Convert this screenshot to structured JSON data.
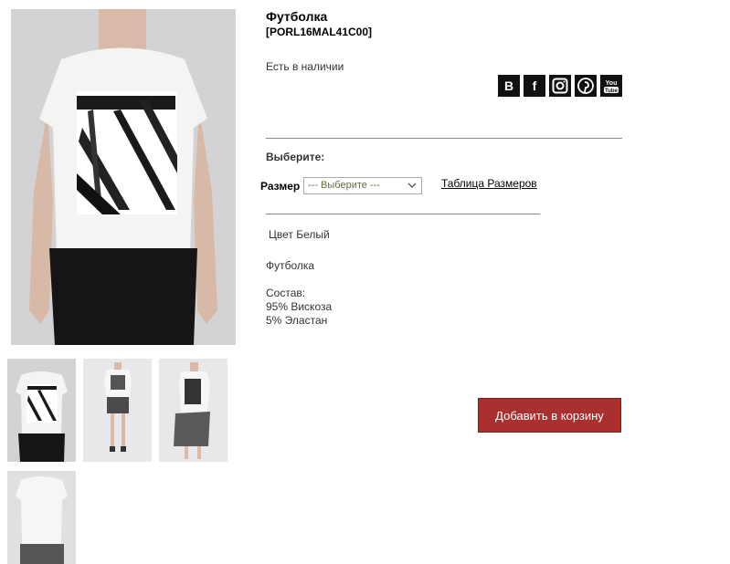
{
  "product": {
    "title": "Футболка",
    "sku": "[PORL16MAL41C00]",
    "availability": "Есть в наличии",
    "choose_label": "Выберите:",
    "size_label": "Размер",
    "size_placeholder": "--- Выберите ---",
    "size_table_link": "Таблица Размеров",
    "color_text": "Цвет Белый",
    "description": "Футболка",
    "composition_title": "Состав:",
    "composition": [
      "95% Вискоза",
      "5% Эластан"
    ],
    "add_to_cart": "Добавить в корзину"
  },
  "social": [
    {
      "name": "vk-icon",
      "glyph": "B"
    },
    {
      "name": "facebook-icon",
      "glyph": "f"
    },
    {
      "name": "instagram-icon",
      "glyph": ""
    },
    {
      "name": "pinterest-icon",
      "glyph": ""
    },
    {
      "name": "youtube-icon",
      "glyph": ""
    }
  ],
  "colors": {
    "button": "#a9302f",
    "icon_bg": "#111111"
  }
}
